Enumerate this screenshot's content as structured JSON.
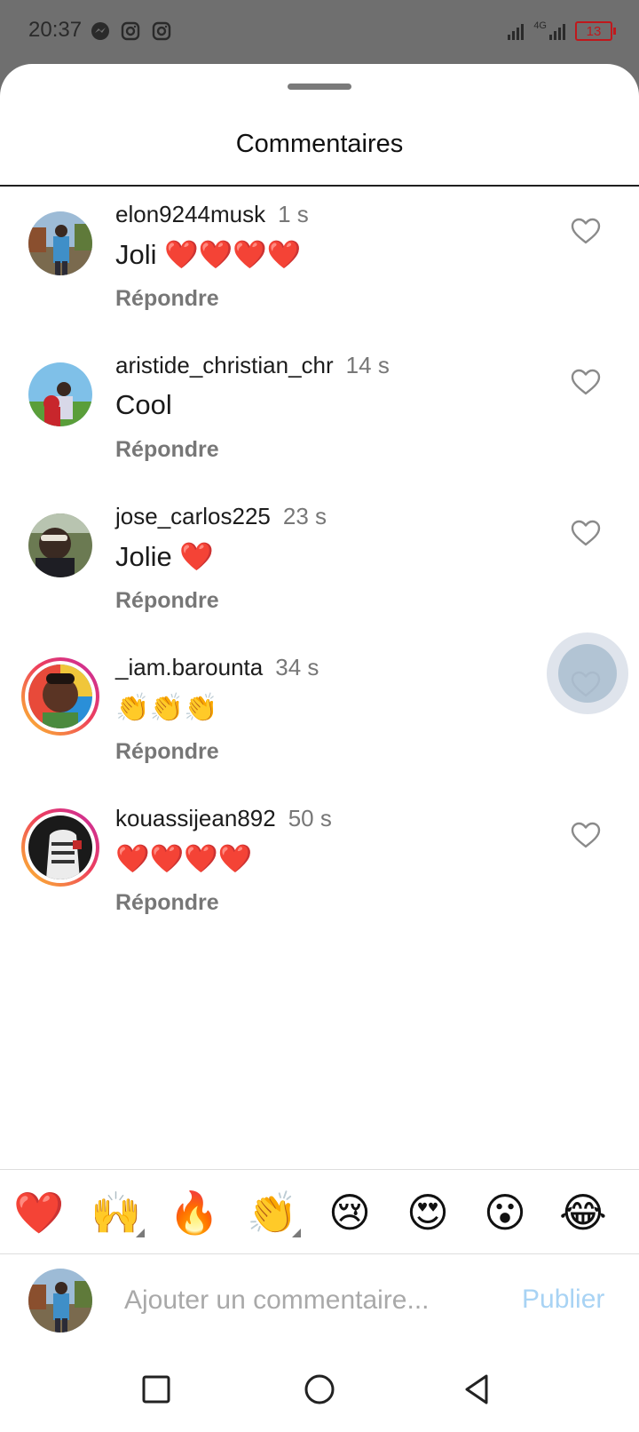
{
  "status_bar": {
    "time": "20:37",
    "notification_icons": [
      "messenger-icon",
      "instagram-icon",
      "instagram-icon"
    ],
    "network_label": "4G",
    "battery_level": "13",
    "battery_color": "#c0181c"
  },
  "sheet": {
    "title": "Commentaires"
  },
  "comments": [
    {
      "username": "elon9244musk",
      "time": "1 s",
      "text": "Joli ❤️❤️❤️❤️",
      "reply_label": "Répondre"
    },
    {
      "username": "aristide_christian_chr",
      "time": "14 s",
      "text": "Cool",
      "reply_label": "Répondre"
    },
    {
      "username": "jose_carlos225",
      "time": "23 s",
      "text": "Jolie ❤️",
      "reply_label": "Répondre"
    },
    {
      "username": "_iam.barounta",
      "time": "34 s",
      "text": "👏👏👏",
      "reply_label": "Répondre"
    },
    {
      "username": "kouassijean892",
      "time": "50 s",
      "text": "❤️❤️❤️❤️",
      "reply_label": "Répondre"
    }
  ],
  "reactions": [
    "❤️",
    "🙌",
    "🔥",
    "👏",
    "😢",
    "😍",
    "😮",
    "😂"
  ],
  "composer": {
    "placeholder": "Ajouter un commentaire...",
    "value": "",
    "publish_label": "Publier",
    "publish_color": "#a8d3f4"
  },
  "nav_bar": {
    "icons": [
      "recents-square-icon",
      "home-circle-icon",
      "back-triangle-icon"
    ]
  }
}
